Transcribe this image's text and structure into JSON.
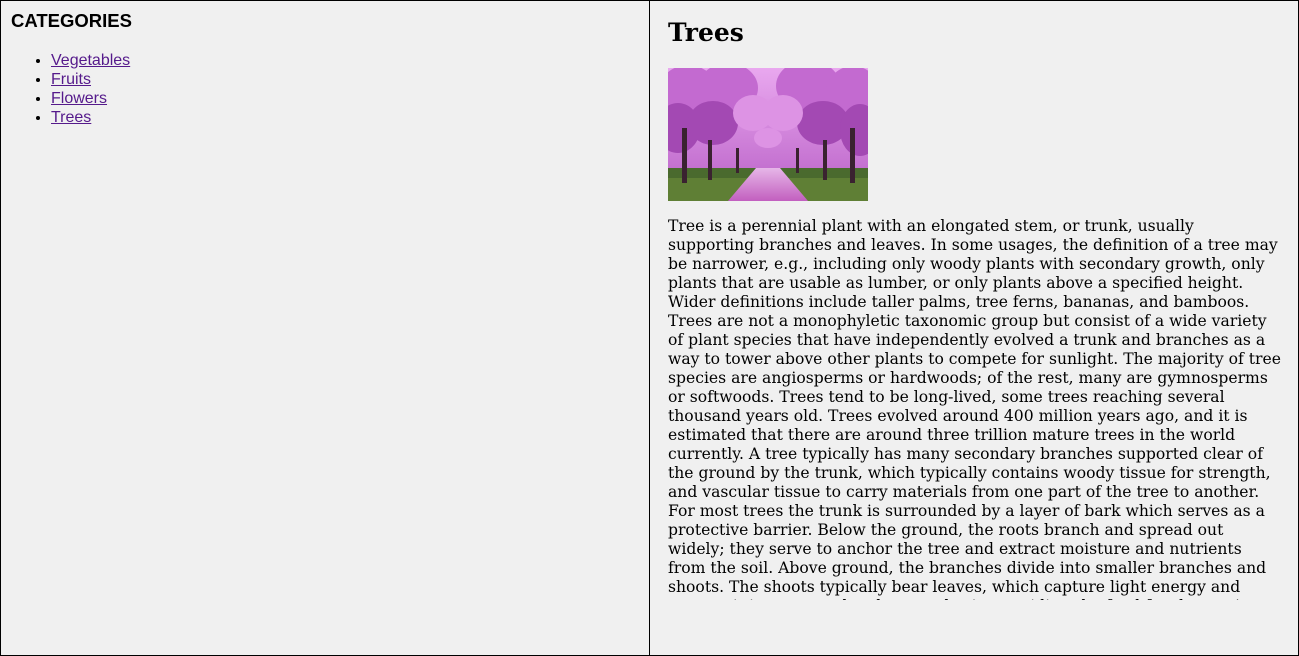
{
  "sidebar": {
    "title": "CATEGORIES",
    "items": [
      {
        "label": "Vegetables"
      },
      {
        "label": "Fruits"
      },
      {
        "label": "Flowers"
      },
      {
        "label": "Trees"
      }
    ],
    "link_color": "#551a8b"
  },
  "article": {
    "title": "Trees",
    "image_icon": "cherry-blossom-tree-avenue-image",
    "body": "Tree is a perennial plant with an elongated stem, or trunk, usually supporting branches and leaves. In some usages, the definition of a tree may be narrower, e.g., including only woody plants with secondary growth, only plants that are usable as lumber, or only plants above a specified height. Wider definitions include taller palms, tree ferns, bananas, and bamboos. Trees are not a monophyletic taxonomic group but consist of a wide variety of plant species that have independently evolved a trunk and branches as a way to tower above other plants to compete for sunlight. The majority of tree species are angiosperms or hardwoods; of the rest, many are gymnosperms or softwoods. Trees tend to be long-lived, some trees reaching several thousand years old. Trees evolved around 400 million years ago, and it is estimated that there are around three trillion mature trees in the world currently. A tree typically has many secondary branches supported clear of the ground by the trunk, which typically contains woody tissue for strength, and vascular tissue to carry materials from one part of the tree to another. For most trees the trunk is surrounded by a layer of bark which serves as a protective barrier. Below the ground, the roots branch and spread out widely; they serve to anchor the tree and extract moisture and nutrients from the soil. Above ground, the branches divide into smaller branches and shoots. The shoots typically bear leaves, which capture light energy and convert it into sugars by photosynthesis, providing the food for the tree's growth and development."
  }
}
